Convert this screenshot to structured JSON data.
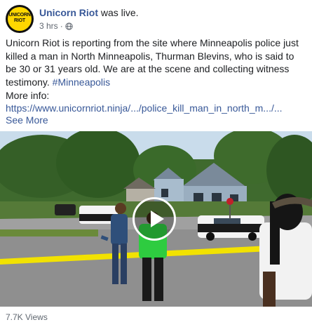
{
  "post": {
    "page_name": "Unicorn Riot",
    "action": " was live.",
    "time": "3 hrs",
    "separator": "·",
    "avatar_text": "UNICORN\nRIOT",
    "text_main": "Unicorn Riot is reporting from the site where Minneapolis police just killed a man in North Minneapolis, Thurman Blevins, who is said to be 30 or 31 years old. We are at the scene and collecting witness testimony. ",
    "hashtag": "#Minneapolis",
    "more_info": "More info:",
    "link": "https://www.unicornriot.ninja/.../police_kill_man_in_north_m.../...",
    "see_more": "See More",
    "views": "7.7K Views"
  },
  "icons": {
    "privacy": "globe-icon",
    "play": "play-icon"
  },
  "colors": {
    "link": "#385898",
    "meta": "#606770",
    "tape": "#f2e200",
    "shirt": "#2ecc40"
  }
}
